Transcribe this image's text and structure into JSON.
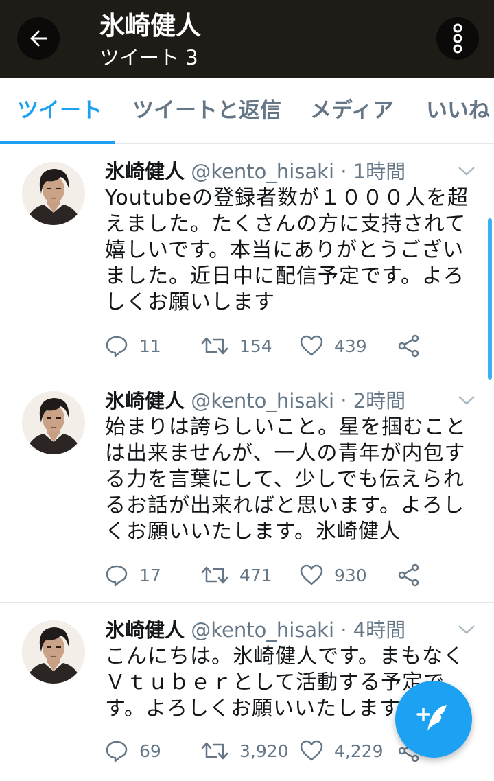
{
  "header": {
    "title": "氷崎健人",
    "subtitle": "ツイート 3"
  },
  "icons": {
    "back": "arrow-left-icon",
    "more": "more-vertical-icon",
    "reply": "reply-icon",
    "retweet": "retweet-icon",
    "like": "heart-icon",
    "share": "share-icon",
    "compose": "compose-tweet-icon",
    "caret": "chevron-down-icon"
  },
  "colors": {
    "header_bg": "#1f1c18",
    "accent": "#1da1f2",
    "secondary_text": "#657786"
  },
  "tabs": [
    {
      "label": "ツイート",
      "active": true
    },
    {
      "label": "ツイートと返信",
      "active": false
    },
    {
      "label": "メディア",
      "active": false
    },
    {
      "label": "いいね",
      "active": false
    }
  ],
  "tweets": [
    {
      "name": "氷崎健人",
      "handle": "@kento_hisaki",
      "separator": "·",
      "time": "1時間",
      "text": "Youtubeの登録者数が１０００人を超えました。たくさんの方に支持されて嬉しいです。本当にありがとうございました。近日中に配信予定です。よろしくお願いします",
      "replies": "11",
      "retweets": "154",
      "likes": "439"
    },
    {
      "name": "氷崎健人",
      "handle": "@kento_hisaki",
      "separator": "·",
      "time": "2時間",
      "text": "始まりは誇らしいこと。星を掴むことは出来ませんが、一人の青年が内包する力を言葉にして、少しでも伝えられるお話が出来ればと思います。よろしくお願いいたします。氷崎健人",
      "replies": "17",
      "retweets": "471",
      "likes": "930"
    },
    {
      "name": "氷崎健人",
      "handle": "@kento_hisaki",
      "separator": "·",
      "time": "4時間",
      "text": "こんにちは。氷崎健人です。まもなくＶｔｕｂｅｒとして活動する予定です。よろしくお願いいたします。",
      "replies": "69",
      "retweets": "3,920",
      "likes": "4,229"
    }
  ]
}
